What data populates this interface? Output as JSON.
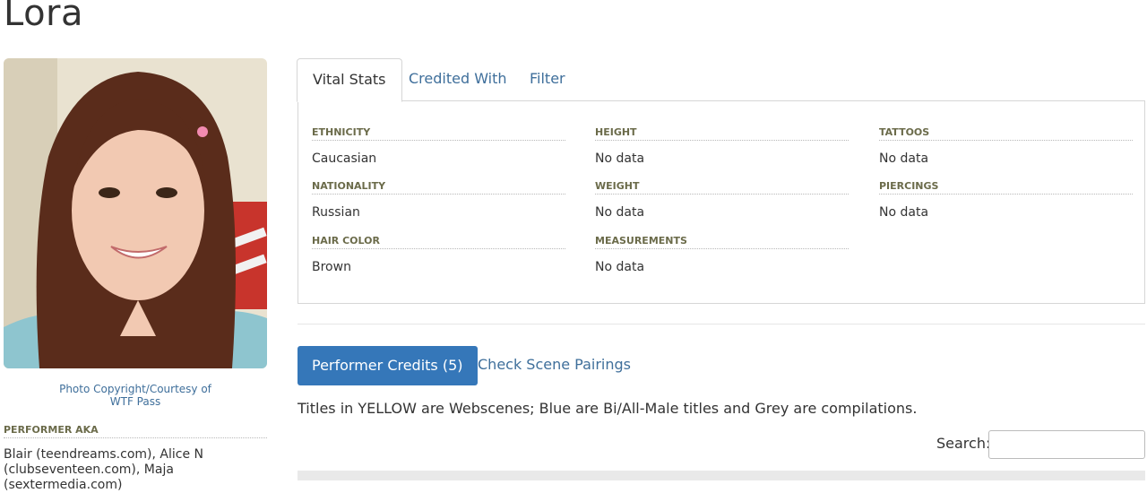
{
  "page": {
    "title": "Lora"
  },
  "photo": {
    "credit_line1": "Photo Copyright/Courtesy of",
    "credit_line2": "WTF Pass"
  },
  "aka": {
    "heading": "PERFORMER AKA",
    "text": "Blair (teendreams.com), Alice N (clubseventeen.com), Maja (sextermedia.com)"
  },
  "tabs": [
    {
      "label": "Vital Stats",
      "active": true
    },
    {
      "label": "Credited With",
      "active": false
    },
    {
      "label": "Filter",
      "active": false
    }
  ],
  "stats": {
    "ethnicity": {
      "label": "ETHNICITY",
      "value": "Caucasian"
    },
    "nationality": {
      "label": "NATIONALITY",
      "value": "Russian"
    },
    "hair_color": {
      "label": "HAIR COLOR",
      "value": "Brown"
    },
    "height": {
      "label": "HEIGHT",
      "value": "No data"
    },
    "weight": {
      "label": "WEIGHT",
      "value": "No data"
    },
    "measurements": {
      "label": "MEASUREMENTS",
      "value": "No data"
    },
    "tattoos": {
      "label": "TATTOOS",
      "value": "No data"
    },
    "piercings": {
      "label": "PIERCINGS",
      "value": "No data"
    }
  },
  "credits": {
    "button_label": "Performer Credits (5)",
    "pairings_link": "Check Scene Pairings",
    "legend": "Titles in YELLOW are Webscenes; Blue are Bi/All-Male titles and Grey are compilations."
  },
  "search": {
    "label": "Search:",
    "value": ""
  },
  "colors": {
    "link": "#3f6f9b",
    "primary_button": "#3577b9",
    "label": "#6b6b4a",
    "border": "#d6d6d6"
  }
}
